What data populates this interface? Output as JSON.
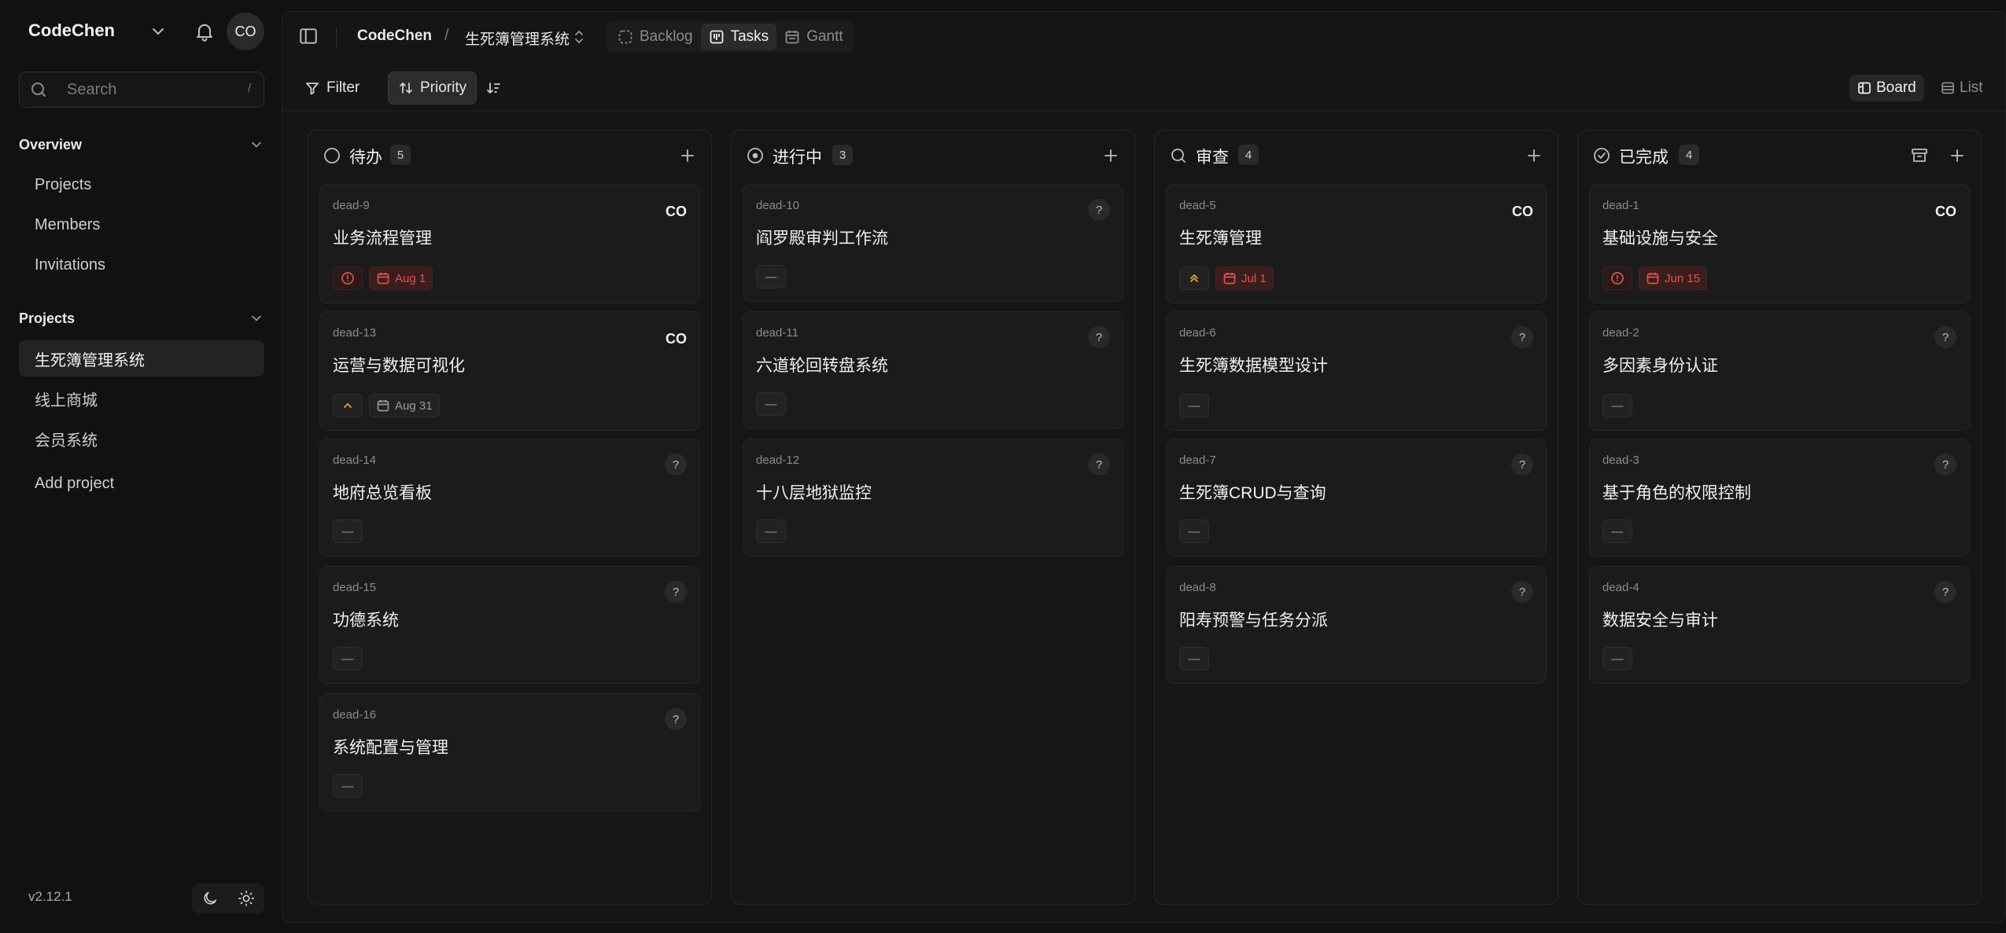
{
  "sidebar": {
    "workspace": "CodeChen",
    "user_initials": "CO",
    "search_placeholder": "Search",
    "search_shortcut": "/",
    "overview": {
      "title": "Overview",
      "items": [
        "Projects",
        "Members",
        "Invitations"
      ]
    },
    "projects": {
      "title": "Projects",
      "items": [
        "生死簿管理系统",
        "线上商城",
        "会员系统"
      ],
      "active": "生死簿管理系统",
      "add": "Add project"
    },
    "version": "v2.12.1"
  },
  "header": {
    "breadcrumb_workspace": "CodeChen",
    "breadcrumb_sep": "/",
    "breadcrumb_project": "生死簿管理系统",
    "tabs": [
      "Backlog",
      "Tasks",
      "Gantt"
    ],
    "active_tab": "Tasks"
  },
  "toolbar": {
    "filter": "Filter",
    "priority": "Priority",
    "board": "Board",
    "list": "List",
    "active_mode": "Board"
  },
  "columns": [
    {
      "title": "待办",
      "count": "5",
      "status_icon": "circle-empty-icon",
      "cards": [
        {
          "id": "dead-9",
          "title": "业务流程管理",
          "assignee": "CO",
          "priority": "urgent",
          "due": "Aug 1",
          "due_overdue": true
        },
        {
          "id": "dead-13",
          "title": "运营与数据可视化",
          "assignee": "CO",
          "priority": "medium",
          "due": "Aug 31",
          "due_overdue": false
        },
        {
          "id": "dead-14",
          "title": "地府总览看板",
          "assignee": "?",
          "priority": "none",
          "due": "",
          "due_overdue": false
        },
        {
          "id": "dead-15",
          "title": "功德系统",
          "assignee": "?",
          "priority": "none",
          "due": "",
          "due_overdue": false
        },
        {
          "id": "dead-16",
          "title": "系统配置与管理",
          "assignee": "?",
          "priority": "none",
          "due": "",
          "due_overdue": false
        }
      ]
    },
    {
      "title": "进行中",
      "count": "3",
      "status_icon": "circle-dot-icon",
      "cards": [
        {
          "id": "dead-10",
          "title": "阎罗殿审判工作流",
          "assignee": "?",
          "priority": "none",
          "due": "",
          "due_overdue": false
        },
        {
          "id": "dead-11",
          "title": "六道轮回转盘系统",
          "assignee": "?",
          "priority": "none",
          "due": "",
          "due_overdue": false
        },
        {
          "id": "dead-12",
          "title": "十八层地狱监控",
          "assignee": "?",
          "priority": "none",
          "due": "",
          "due_overdue": false
        }
      ]
    },
    {
      "title": "审查",
      "count": "4",
      "status_icon": "search-icon",
      "cards": [
        {
          "id": "dead-5",
          "title": "生死簿管理",
          "assignee": "CO",
          "priority": "high",
          "due": "Jul 1",
          "due_overdue": true
        },
        {
          "id": "dead-6",
          "title": "生死簿数据模型设计",
          "assignee": "?",
          "priority": "none",
          "due": "",
          "due_overdue": false
        },
        {
          "id": "dead-7",
          "title": "生死簿CRUD与查询",
          "assignee": "?",
          "priority": "none",
          "due": "",
          "due_overdue": false
        },
        {
          "id": "dead-8",
          "title": "阳寿预警与任务分派",
          "assignee": "?",
          "priority": "none",
          "due": "",
          "due_overdue": false
        }
      ]
    },
    {
      "title": "已完成",
      "count": "4",
      "status_icon": "check-circle-icon",
      "cards": [
        {
          "id": "dead-1",
          "title": "基础设施与安全",
          "assignee": "CO",
          "priority": "urgent",
          "due": "Jun 15",
          "due_overdue": true
        },
        {
          "id": "dead-2",
          "title": "多因素身份认证",
          "assignee": "?",
          "priority": "none",
          "due": "",
          "due_overdue": false
        },
        {
          "id": "dead-3",
          "title": "基于角色的权限控制",
          "assignee": "?",
          "priority": "none",
          "due": "",
          "due_overdue": false
        },
        {
          "id": "dead-4",
          "title": "数据安全与审计",
          "assignee": "?",
          "priority": "none",
          "due": "",
          "due_overdue": false
        }
      ]
    }
  ],
  "colors": {
    "background": "#111111",
    "panel": "#151515",
    "card": "#1b1b1b",
    "overdue": "#e0524f",
    "high_priority": "#e0a33a"
  }
}
